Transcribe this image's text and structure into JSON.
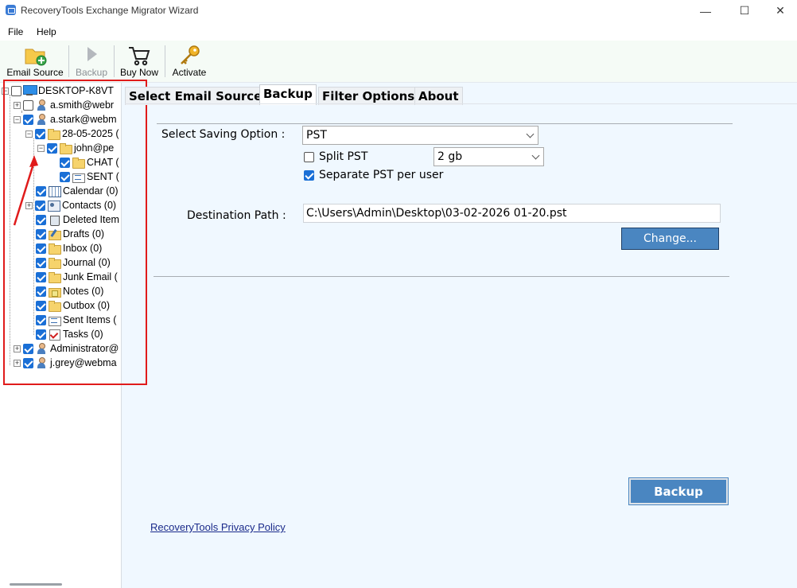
{
  "window": {
    "title": "RecoveryTools Exchange Migrator Wizard",
    "controls": {
      "minimize": "—",
      "maximize": "☐",
      "close": "✕"
    }
  },
  "menu": {
    "file": "File",
    "help": "Help"
  },
  "toolbar": {
    "email_source": "Email Source",
    "backup": "Backup",
    "buy_now": "Buy Now",
    "activate": "Activate"
  },
  "tree": {
    "root": "DESKTOP-K8VT",
    "users": [
      "a.smith@webr",
      "a.stark@webm"
    ],
    "date_folder": "28-05-2025 (",
    "john": "john@pe",
    "chat": "CHAT (",
    "sent_sub": "SENT (",
    "folders": [
      "Calendar (0)",
      "Contacts (0)",
      "Deleted Item",
      "Drafts (0)",
      "Inbox (0)",
      "Journal (0)",
      "Junk Email (",
      "Notes (0)",
      "Outbox (0)",
      "Sent Items (",
      "Tasks (0)"
    ],
    "other_users": [
      "Administrator@",
      "j.grey@webma"
    ]
  },
  "tabs": [
    "Select Email Source",
    "Backup",
    "Filter Options",
    "About"
  ],
  "active_tab": "Backup",
  "backup_form": {
    "saving_option_label": "Select Saving Option :",
    "saving_option_value": "PST",
    "split_pst_label": "Split PST",
    "split_pst_checked": false,
    "split_size_value": "2 gb",
    "separate_pst_label": "Separate PST per user",
    "separate_pst_checked": true,
    "destination_label": "Destination Path :",
    "destination_value": "C:\\Users\\Admin\\Desktop\\03-02-2026 01-20.pst",
    "change_button": "Change...",
    "backup_button": "Backup",
    "privacy_link": "RecoveryTools Privacy Policy"
  },
  "colors": {
    "accent_blue": "#4a86c1",
    "checkbox_blue": "#1a6fd6",
    "highlight_red": "#e01b1b",
    "panel_bg": "#f0f8ff"
  }
}
